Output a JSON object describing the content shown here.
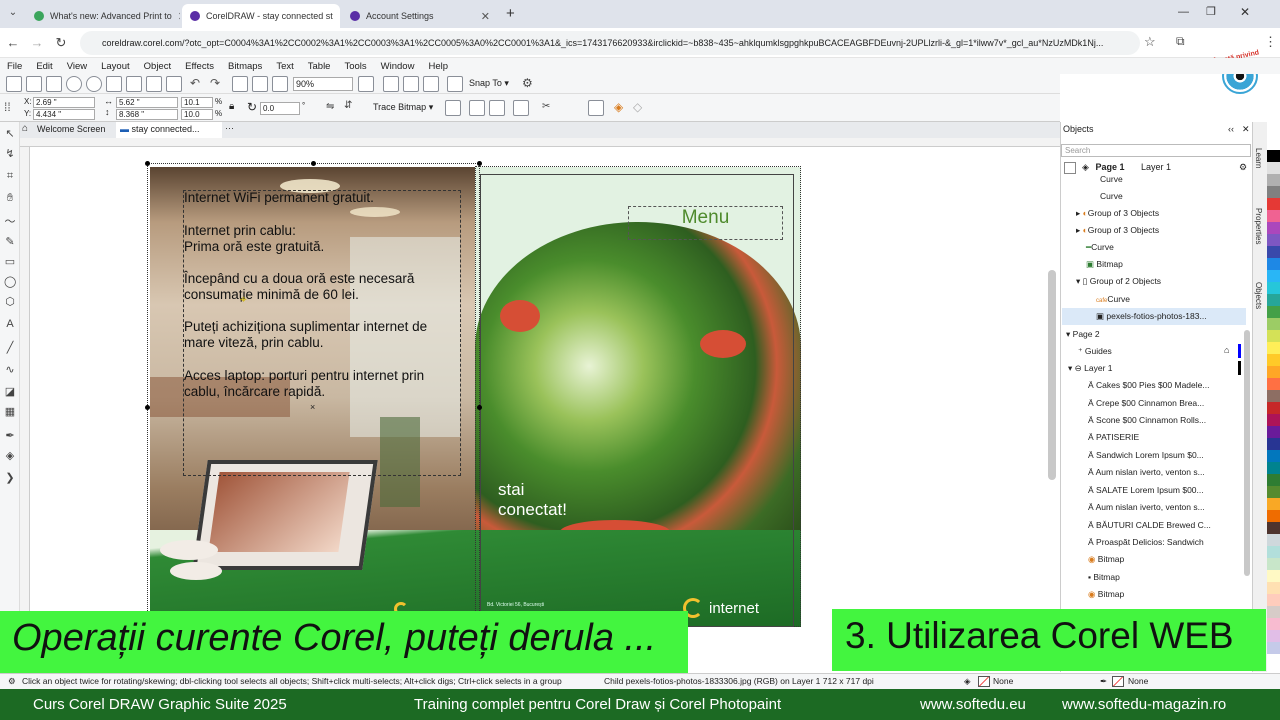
{
  "browser": {
    "tabs": [
      {
        "label": "What's new: Advanced Print to",
        "color": "#3ba55c"
      },
      {
        "label": "CorelDRAW - stay connected st",
        "color": "#5a2ea6"
      },
      {
        "label": "Account Settings",
        "color": "#5a2ea6"
      }
    ],
    "new_tab": "+",
    "url": "coreldraw.corel.com/?otc_opt=C0004%3A1%2CC0002%3A1%2CC0003%3A1%2CC0005%3A0%2CC0001%3A1&_ics=1743176620933&irclickid=~b838~435~ahklqumklsgpghkpuBCACEAGBFDEuvnj-2UPLlzrli-&_gl=1*ilww7v*_gcl_au*NzUzMDk1Nj...",
    "brand_badge": "Învață privind"
  },
  "menu": [
    "File",
    "Edit",
    "View",
    "Layout",
    "Object",
    "Effects",
    "Bitmaps",
    "Text",
    "Table",
    "Tools",
    "Window",
    "Help"
  ],
  "toolbar": {
    "zoom": "90%",
    "snap_to": "Snap To",
    "x": "2.69 \"",
    "y": "4.434 \"",
    "w": "5.62 \"",
    "h": "8.368 \"",
    "sx": "10.1",
    "sy": "10.0",
    "pct": "%",
    "rotation": "0.0",
    "deg": "°",
    "trace_bitmap": "Trace Bitmap"
  },
  "doc_tabs": [
    "Welcome Screen",
    "stay connected..."
  ],
  "brochure": {
    "left_text": [
      "Internet WiFi permanent gratuit.",
      "Internet prin cablu:",
      "Prima oră este gratuită.",
      "Începând cu a doua oră este necesară",
      "consumație minimă de 60 lei.",
      "Puteți achiziționa suplimentar internet de",
      "mare viteză, prin cablu.",
      "Acces laptop: porturi pentru internet prin",
      "cablu, încărcare rapidă."
    ],
    "menu_label": "Menu",
    "slogan_line1": "stai",
    "slogan_line2": "conectat!",
    "brand": "internet",
    "address": "Bd. Victoriei 56, București"
  },
  "objects_panel": {
    "title": "Objects",
    "search_placeholder": "Search",
    "page1": "Page 1",
    "layer1": "Layer 1",
    "items": [
      "Curve",
      "Curve",
      "Group of 3 Objects",
      "Group of 3 Objects",
      "Curve",
      "Bitmap",
      "Group of 2 Objects",
      "Curve",
      "pexels-fotios-photos-183...",
      "Page 2",
      "Guides",
      "Layer 1",
      "Cakes  $00 Pies  $00 Madele...",
      "Crepe  $00 Cinnamon Brea...",
      "Scone  $00 Cinnamon Rolls...",
      "PATISERIE",
      "Sandwich  Lorem Ipsum $0...",
      "Aum nislan iverto, venton s...",
      "SALATE  Lorem Ipsum $00...",
      "Aum nislan iverto, venton s...",
      "BĂUTURI CALDE  Brewed C...",
      "Proaspăt  Delicios: Sandwich",
      "Bitmap",
      "Bitmap",
      "Bitmap"
    ],
    "dock_labels": [
      "Learn",
      "Properties",
      "Objects"
    ]
  },
  "status": {
    "hint": "Click an object twice for rotating/skewing; dbl-clicking tool selects all objects; Shift+click multi-selects; Alt+click digs; Ctrl+click selects in a group",
    "selection": "Child pexels-fotios-photos-1833306.jpg (RGB) on Layer 1  712 x 717 dpi",
    "fill": "None",
    "outline": "None"
  },
  "overlay": {
    "left_banner": "Operații curente Corel, puteți derula ...",
    "right_banner": "3. Utilizarea Corel WEB"
  },
  "footer": {
    "course": "Curs Corel DRAW Graphic Suite 2025",
    "subtitle": "Training complet pentru Corel Draw și Corel Photopaint",
    "site1": "www.softedu.eu",
    "site2": "www.softedu-magazin.ro"
  },
  "palette_colors": [
    "#ffffff",
    "#000000",
    "#e0e0e0",
    "#b0b0b0",
    "#808080",
    "#e53935",
    "#f06292",
    "#ab47bc",
    "#7e57c2",
    "#3949ab",
    "#1e88e5",
    "#29b6f6",
    "#26c6da",
    "#26a69a",
    "#43a047",
    "#9ccc65",
    "#d4e157",
    "#ffee58",
    "#ffca28",
    "#ffa726",
    "#ff7043",
    "#8d6e63",
    "#c62828",
    "#ad1457",
    "#6a1b9a",
    "#283593",
    "#0277bd",
    "#00838f",
    "#2e7d32",
    "#558b2f",
    "#f9a825",
    "#ef6c00",
    "#4e342e",
    "#cfd8dc",
    "#b2dfdb",
    "#c8e6c9",
    "#fff9c4",
    "#ffe0b2",
    "#ffccbc",
    "#d7ccc8",
    "#f8bbd0",
    "#e1bee7",
    "#c5cae9"
  ]
}
